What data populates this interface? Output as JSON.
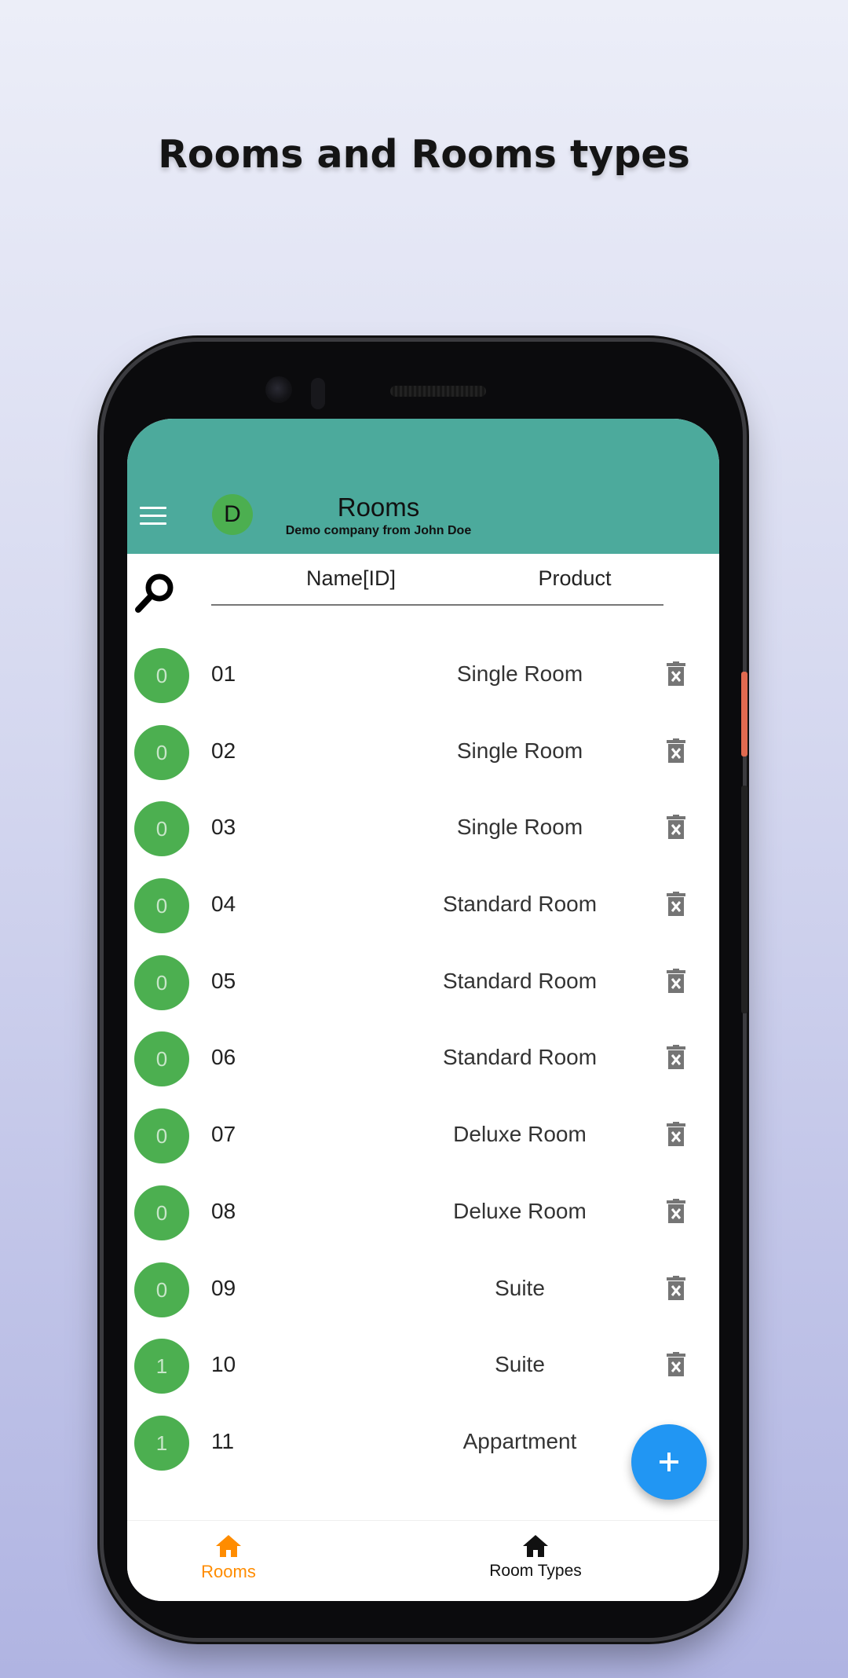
{
  "headline": "Rooms and Rooms types",
  "appbar": {
    "avatar_letter": "D",
    "title": "Rooms",
    "subtitle": "Demo company from John Doe"
  },
  "table": {
    "columns": [
      "Name[ID]",
      "Product"
    ],
    "rows": [
      {
        "badge": "0",
        "id": "01",
        "product": "Single Room"
      },
      {
        "badge": "0",
        "id": "02",
        "product": "Single Room"
      },
      {
        "badge": "0",
        "id": "03",
        "product": "Single Room"
      },
      {
        "badge": "0",
        "id": "04",
        "product": "Standard Room"
      },
      {
        "badge": "0",
        "id": "05",
        "product": "Standard Room"
      },
      {
        "badge": "0",
        "id": "06",
        "product": "Standard Room"
      },
      {
        "badge": "0",
        "id": "07",
        "product": "Deluxe Room"
      },
      {
        "badge": "0",
        "id": "08",
        "product": "Deluxe Room"
      },
      {
        "badge": "0",
        "id": "09",
        "product": "Suite"
      },
      {
        "badge": "1",
        "id": "10",
        "product": "Suite"
      },
      {
        "badge": "1",
        "id": "11",
        "product": "Appartment"
      }
    ]
  },
  "bottom_nav": {
    "items": [
      {
        "label": "Rooms",
        "icon": "home-icon",
        "active": true
      },
      {
        "label": "Room Types",
        "icon": "home-icon",
        "active": false
      }
    ]
  },
  "colors": {
    "appbar": "#4caa9c",
    "badge": "#4caf50",
    "fab": "#2196f3",
    "active_nav": "#ff8c00"
  }
}
